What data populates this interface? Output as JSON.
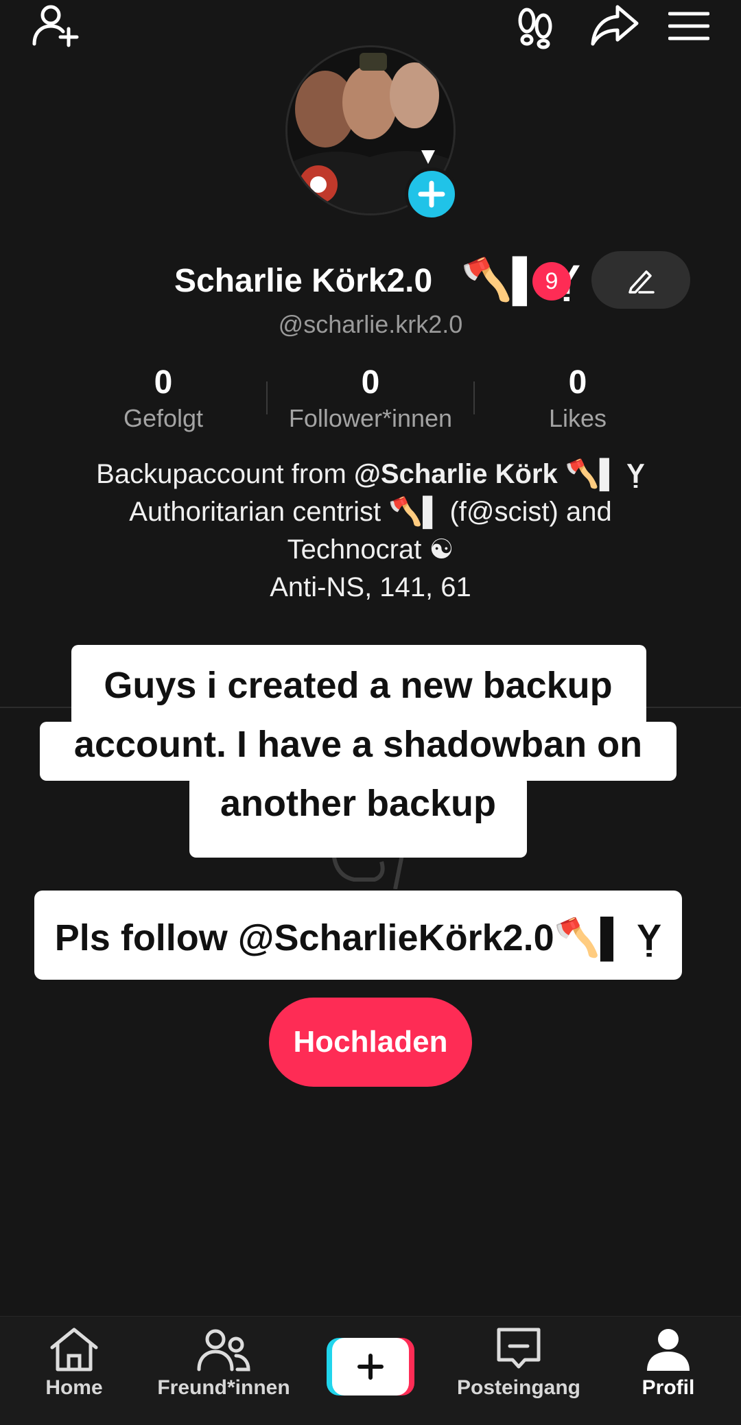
{
  "topbar": {
    "add_friend_icon": "person-add-icon",
    "footprint_icon": "footprint-icon",
    "share_icon": "share-icon",
    "menu_icon": "hamburger-menu-icon"
  },
  "profile": {
    "display_name": "Scharlie Körk2.0",
    "name_decoration": "🪓▌ Ỵ",
    "notification_count": "9",
    "username": "@scharlie.krk2.0",
    "stats": [
      {
        "value": "0",
        "label": "Gefolgt"
      },
      {
        "value": "0",
        "label": "Follower*innen"
      },
      {
        "value": "0",
        "label": "Likes"
      }
    ],
    "bio": {
      "line1_prefix": "Backupaccount from ",
      "line1_bold": "@Scharlie Körk 🪓▌ Ỵ",
      "line2": "Authoritarian centrist 🪓▌ (f@scist) and",
      "line3": "Technocrat ☯",
      "line4": "Anti-NS, 141, 61"
    }
  },
  "captions": {
    "line1": "Guys i created a new backup",
    "line2": "account. I have a shadowban on",
    "line3": "another backup",
    "follow": "Pls follow @ScharlieKörk2.0🪓▌ Ỵ"
  },
  "upload_button": "Hochladen",
  "bottom_nav": {
    "home": "Home",
    "friends": "Freund*innen",
    "inbox": "Posteingang",
    "profile": "Profil"
  },
  "colors": {
    "background": "#161616",
    "accent_red": "#fe2c55",
    "accent_cyan": "#20c3e8"
  }
}
